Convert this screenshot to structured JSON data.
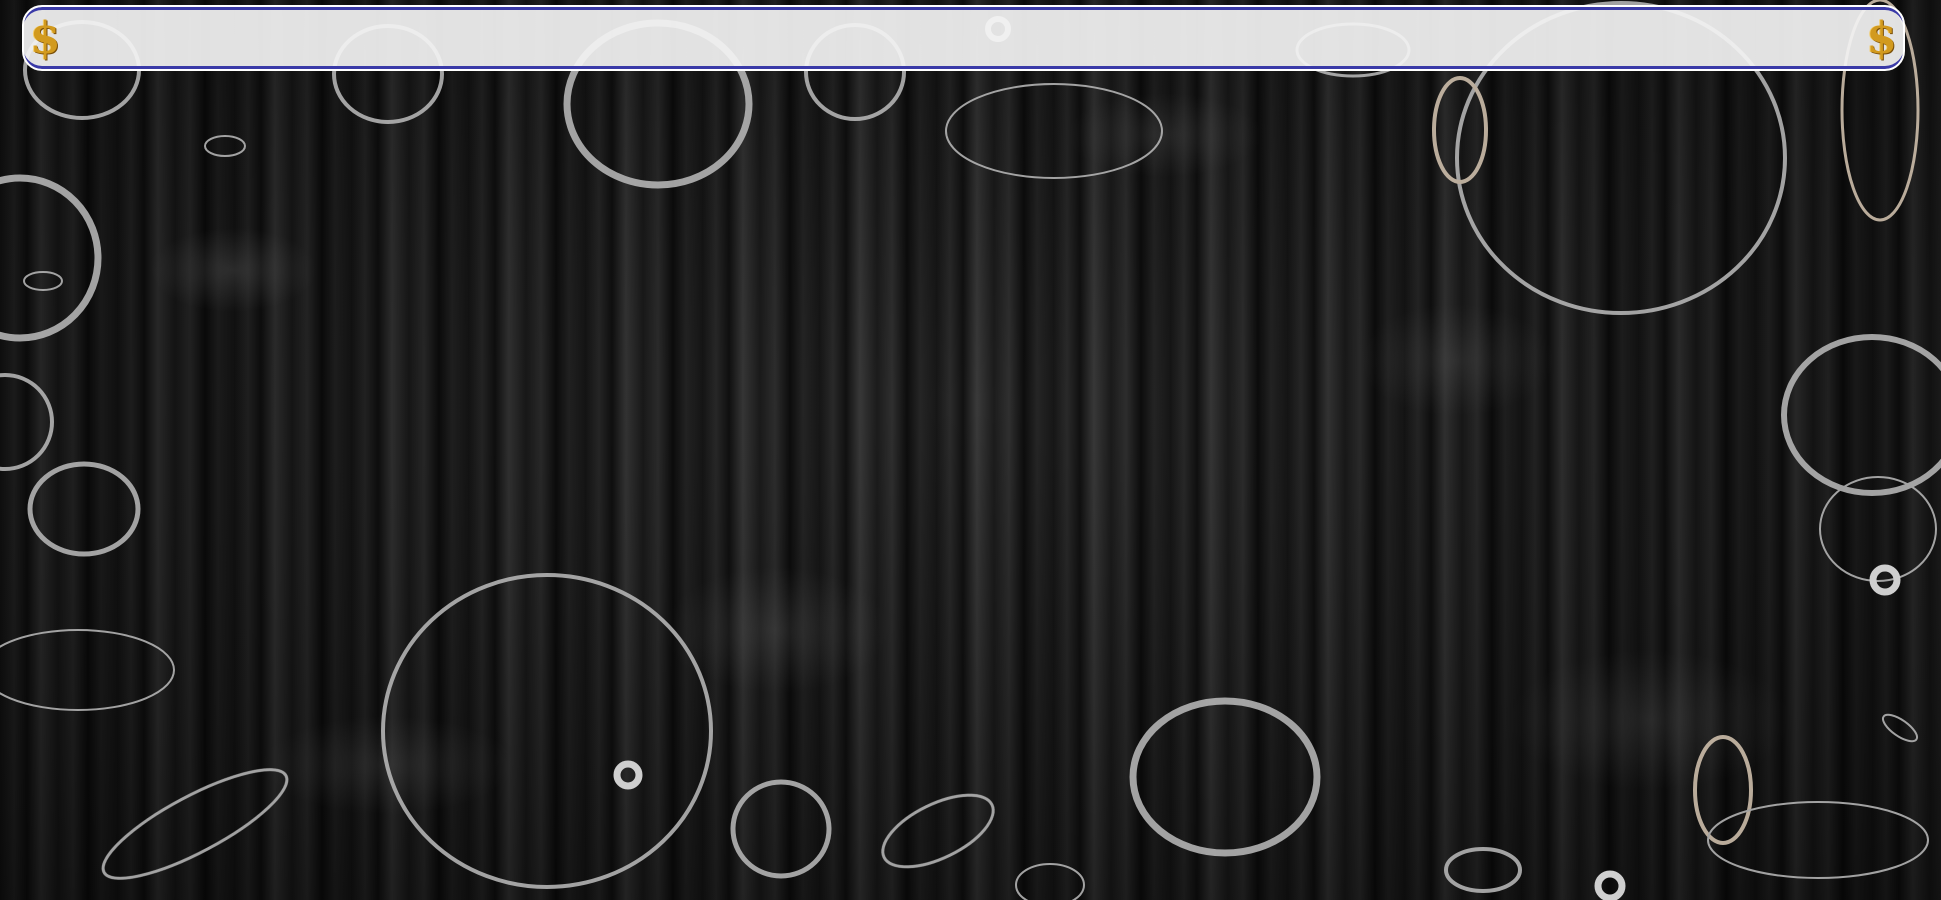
{
  "scene": {
    "background": "dark-grey-blurred-forest",
    "accent_color": "#3a3aa8",
    "bubble_color": "#bdbdbd",
    "bubble_tint_color": "#d8c8b4"
  },
  "top_bar": {
    "background_color": "#f2f2f2",
    "border_color": "#3a3aa8",
    "left_icon": "dollar-coin-icon",
    "left_symbol": "$",
    "right_icon": "dollar-coin-icon",
    "right_symbol": "$"
  }
}
